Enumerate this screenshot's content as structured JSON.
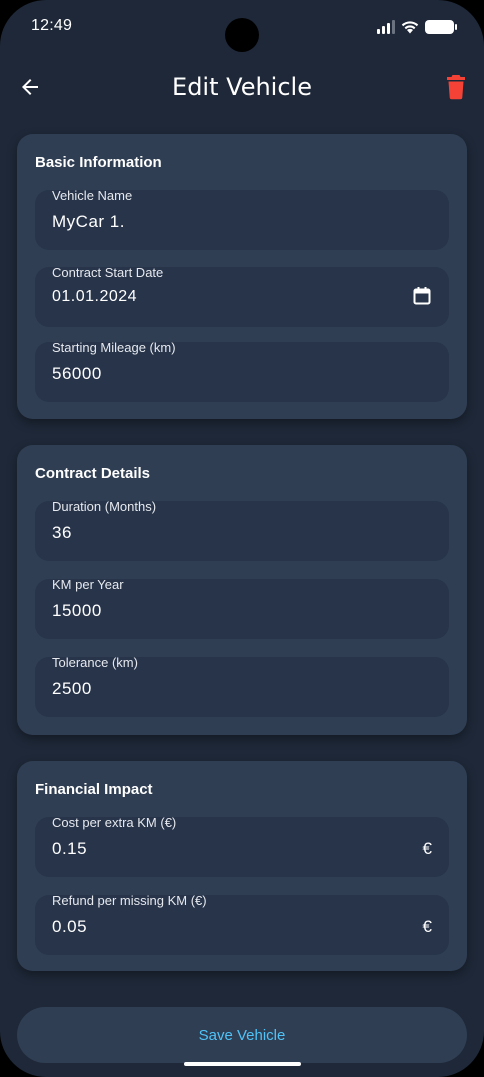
{
  "status_bar": {
    "time": "12:49"
  },
  "app_bar": {
    "title": "Edit Vehicle",
    "back_icon": "arrow-left-icon",
    "delete_icon": "trash-icon",
    "delete_color": "#f44336"
  },
  "basic_info": {
    "title": "Basic Information",
    "vehicle_name": {
      "label": "Vehicle Name",
      "value": "MyCar 1."
    },
    "contract_start": {
      "label": "Contract Start Date",
      "value": "01.01.2024",
      "icon": "calendar-icon"
    },
    "starting_mileage": {
      "label": "Starting Mileage (km)",
      "value": "56000"
    }
  },
  "contract_details": {
    "title": "Contract Details",
    "duration": {
      "label": "Duration (Months)",
      "value": "36"
    },
    "km_per_year": {
      "label": "KM per Year",
      "value": "15000"
    },
    "tolerance": {
      "label": "Tolerance (km)",
      "value": "2500"
    }
  },
  "financial_impact": {
    "title": "Financial Impact",
    "cost_extra": {
      "label": "Cost per extra KM (€)",
      "value": "0.15",
      "suffix": "€"
    },
    "refund_missing": {
      "label": "Refund per missing KM (€)",
      "value": "0.05",
      "suffix": "€"
    }
  },
  "actions": {
    "save_label": "Save Vehicle",
    "save_color": "#4fc3f7"
  }
}
